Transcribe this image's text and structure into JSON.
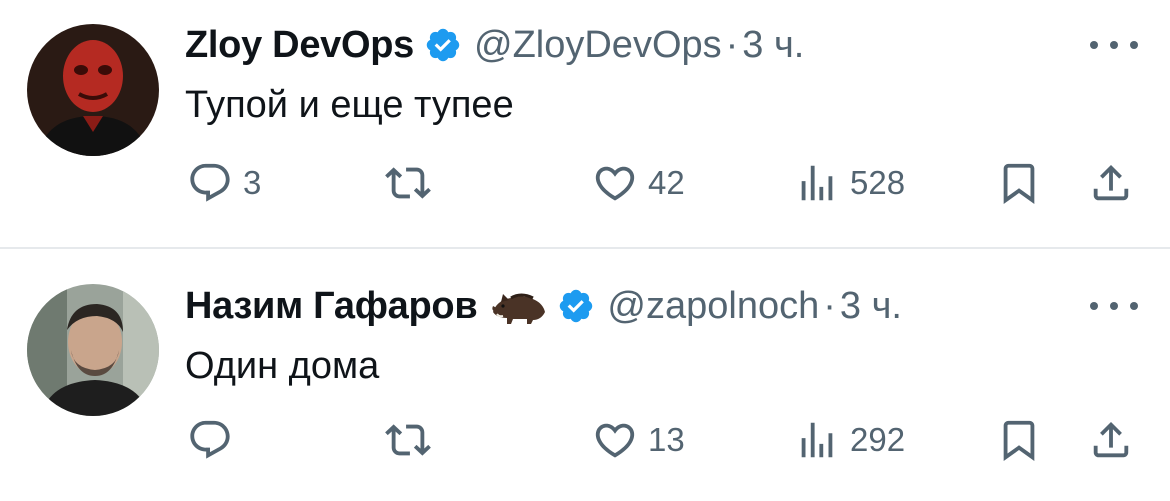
{
  "tweets": [
    {
      "author_name": "Zloy DevOps",
      "handle": "@ZloyDevOps",
      "separator": "·",
      "time": "3 ч.",
      "text": "Тупой и еще тупее",
      "replies": "3",
      "retweets": "",
      "likes": "42",
      "views": "528"
    },
    {
      "author_name": "Назим Гафаров",
      "handle": "@zapolnoch",
      "separator": "·",
      "time": "3 ч.",
      "text": "Один дома",
      "replies": "",
      "retweets": "",
      "likes": "13",
      "views": "292"
    }
  ],
  "icons": {
    "verified": "verified-badge-icon",
    "more": "more-icon",
    "reply": "reply-icon",
    "retweet": "retweet-icon",
    "like": "like-icon",
    "views": "views-icon",
    "bookmark": "bookmark-icon",
    "share": "share-icon"
  },
  "colors": {
    "verified": "#1d9bf0",
    "text": "#0f1419",
    "secondary": "#536471",
    "divider": "#e6e9ec"
  }
}
